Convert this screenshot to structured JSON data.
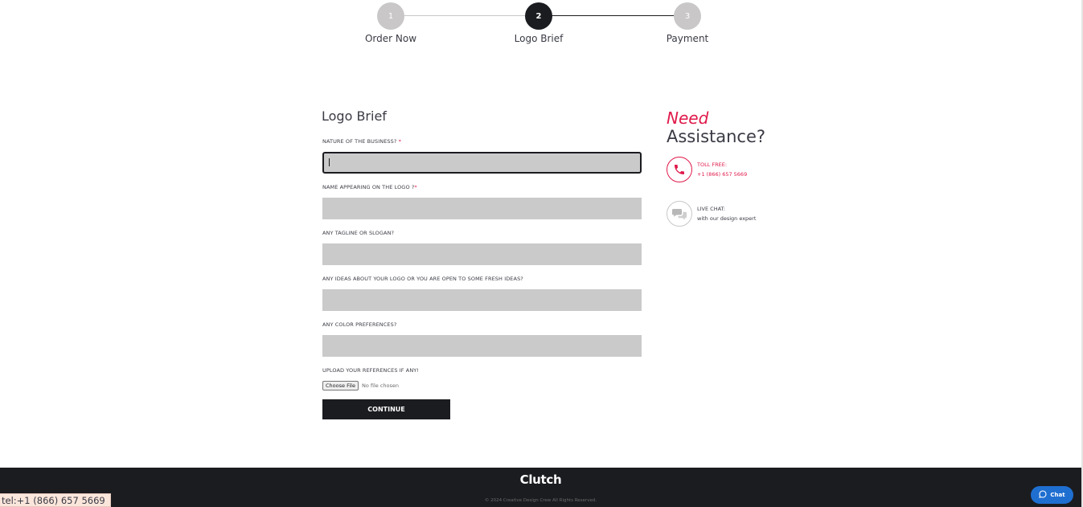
{
  "stepper": {
    "steps": [
      {
        "number": "1",
        "label": "Order Now",
        "state": "inactive"
      },
      {
        "number": "2",
        "label": "Logo Brief",
        "state": "active"
      },
      {
        "number": "3",
        "label": "Payment",
        "state": "inactive"
      }
    ]
  },
  "form": {
    "title": "Logo Brief",
    "fields": [
      {
        "label": "NATURE OF THE BUSINESS?",
        "required_mark": "*",
        "value": "",
        "focused": true
      },
      {
        "label": "NAME APPEARING ON THE LOGO ?",
        "required_mark": "*",
        "value": ""
      },
      {
        "label": "ANY TAGLINE OR SLOGAN?",
        "value": ""
      },
      {
        "label": "ANY IDEAS ABOUT YOUR LOGO OR YOU ARE OPEN TO SOME FRESH IDEAS?",
        "value": ""
      },
      {
        "label": "ANY COLOR PREFERENCES?",
        "value": ""
      }
    ],
    "upload": {
      "label": "UPLOAD YOUR REFERENCES IF ANY!",
      "button_label": "Choose File",
      "status": "No file chosen"
    },
    "continue_label": "CONTINUE"
  },
  "assistance": {
    "need": "Need",
    "heading": "Assistance?",
    "toll_free": {
      "title": "TOLL FREE:",
      "value": "+1 (866) 657 5669",
      "icon": "phone-icon"
    },
    "live_chat": {
      "title": "LIVE CHAT:",
      "value": "with our design expert",
      "icon": "chat-bubbles-icon"
    }
  },
  "footer": {
    "logo_text": "Clutch",
    "copyright": "© 2024 Creative Design Crew All Rights Reserved."
  },
  "status_bar": {
    "link": "tel:+1 (866) 657 5669"
  },
  "chat_widget": {
    "label": "Chat",
    "icon": "chat-icon"
  },
  "colors": {
    "accent": "#e0194a",
    "dark": "#1b1c20",
    "input_bg": "#cbcacb",
    "chat_blue": "#1f6fd1"
  }
}
